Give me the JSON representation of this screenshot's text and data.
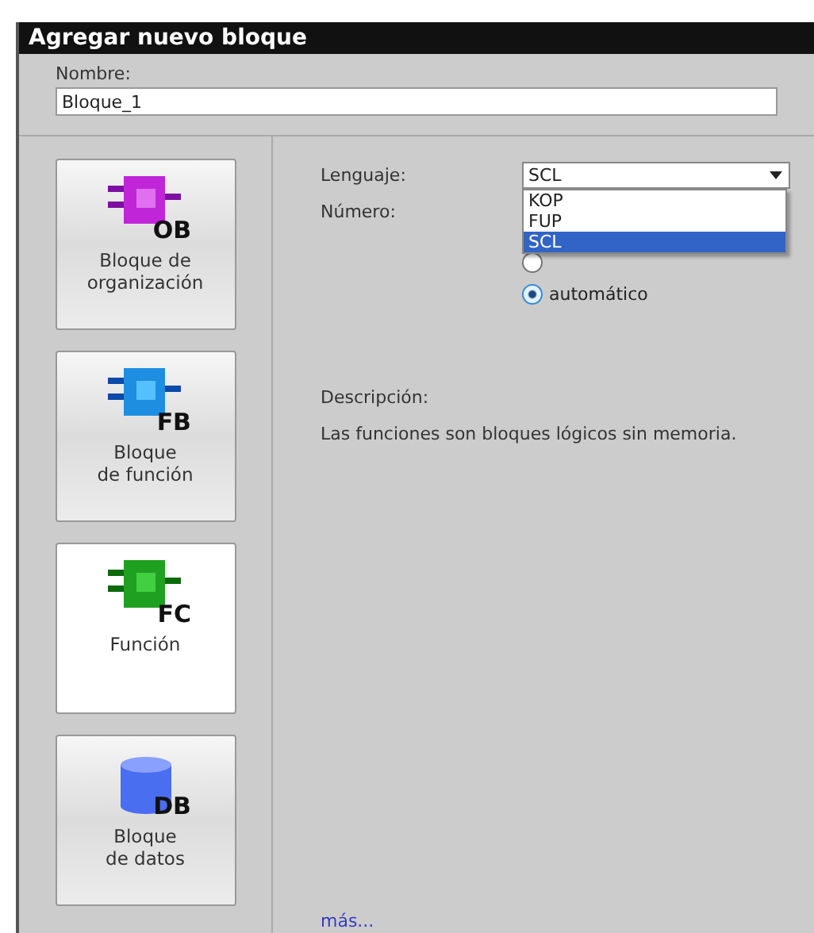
{
  "window": {
    "title": "Agregar nuevo bloque"
  },
  "name_field": {
    "label": "Nombre:",
    "value": "Bloque_1"
  },
  "block_types": [
    {
      "kind": "ob",
      "label_lines": [
        "Bloque de",
        "organización"
      ],
      "code": "OB",
      "selected": false
    },
    {
      "kind": "fb",
      "label_lines": [
        "Bloque",
        "de función"
      ],
      "code": "FB",
      "selected": false
    },
    {
      "kind": "fc",
      "label_lines": [
        "Función"
      ],
      "code": "FC",
      "selected": true
    },
    {
      "kind": "db",
      "label_lines": [
        "Bloque",
        "de datos"
      ],
      "code": "DB",
      "selected": false
    }
  ],
  "language": {
    "label": "Lenguaje:",
    "value": "SCL",
    "expanded": true,
    "options": [
      {
        "label": "KOP",
        "selected": false
      },
      {
        "label": "FUP",
        "selected": false
      },
      {
        "label": "SCL",
        "selected": true
      }
    ]
  },
  "number": {
    "label": "Número:",
    "radios": [
      {
        "selected": false
      },
      {
        "label": "automático",
        "selected": true
      }
    ]
  },
  "description": {
    "label": "Descripción:",
    "text": "Las funciones son bloques lógicos sin memoria."
  },
  "more_link": "más..."
}
